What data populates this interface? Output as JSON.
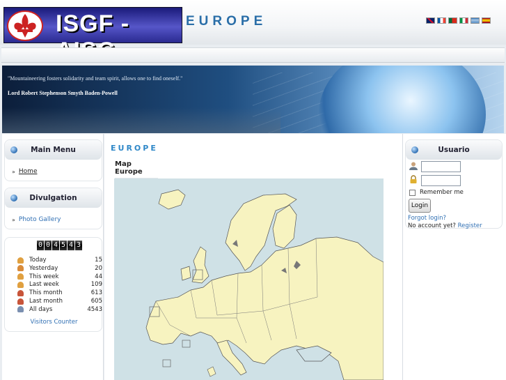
{
  "header": {
    "logo_text": "ISGF - AISG",
    "site_title": "EUROPE",
    "languages": [
      {
        "name": "English",
        "icon": "flag-uk-icon"
      },
      {
        "name": "Français",
        "icon": "flag-fr-icon"
      },
      {
        "name": "Português",
        "icon": "flag-pt-icon"
      },
      {
        "name": "Italiano",
        "icon": "flag-it-icon"
      },
      {
        "name": "Ελληνικά",
        "icon": "flag-gr-icon"
      },
      {
        "name": "Español",
        "icon": "flag-es-icon"
      }
    ]
  },
  "banner": {
    "quote": "\"Mountaineering fosters solidarity and team spirit, allows one to find oneself.\"",
    "author": "Lord Robert Stephenson Smyth Baden-Powell"
  },
  "left": {
    "main_menu": {
      "title": "Main Menu",
      "items": [
        {
          "label": "Home"
        }
      ]
    },
    "divulgation": {
      "title": "Divulgation",
      "items": [
        {
          "label": "Photo Gallery"
        }
      ]
    },
    "counter": {
      "total_display": "004543",
      "rows": [
        {
          "label": "Today",
          "value": "15",
          "color": "#e0a040"
        },
        {
          "label": "Yesterday",
          "value": "20",
          "color": "#d98b3a"
        },
        {
          "label": "This week",
          "value": "44",
          "color": "#e0a040"
        },
        {
          "label": "Last week",
          "value": "109",
          "color": "#e0a040"
        },
        {
          "label": "This month",
          "value": "613",
          "color": "#c8553a"
        },
        {
          "label": "Last month",
          "value": "605",
          "color": "#c8553a"
        },
        {
          "label": "All days",
          "value": "4543",
          "color": "#7a8fb0"
        }
      ],
      "footer_link": "Visitors Counter"
    }
  },
  "main": {
    "heading": "EUROPE",
    "map_title": "Map Europe"
  },
  "right": {
    "login": {
      "title": "Usuario",
      "username_value": "",
      "password_value": "",
      "remember_label": "Remember me",
      "login_button": "Login",
      "forgot_link": "Forgot login?",
      "no_account_text": "No account yet?",
      "register_link": "Register"
    }
  },
  "colors": {
    "accent": "#2f88c8",
    "link": "#2f6fb3",
    "map_land": "#f7f3c0",
    "map_sea": "#cfe1e6"
  }
}
